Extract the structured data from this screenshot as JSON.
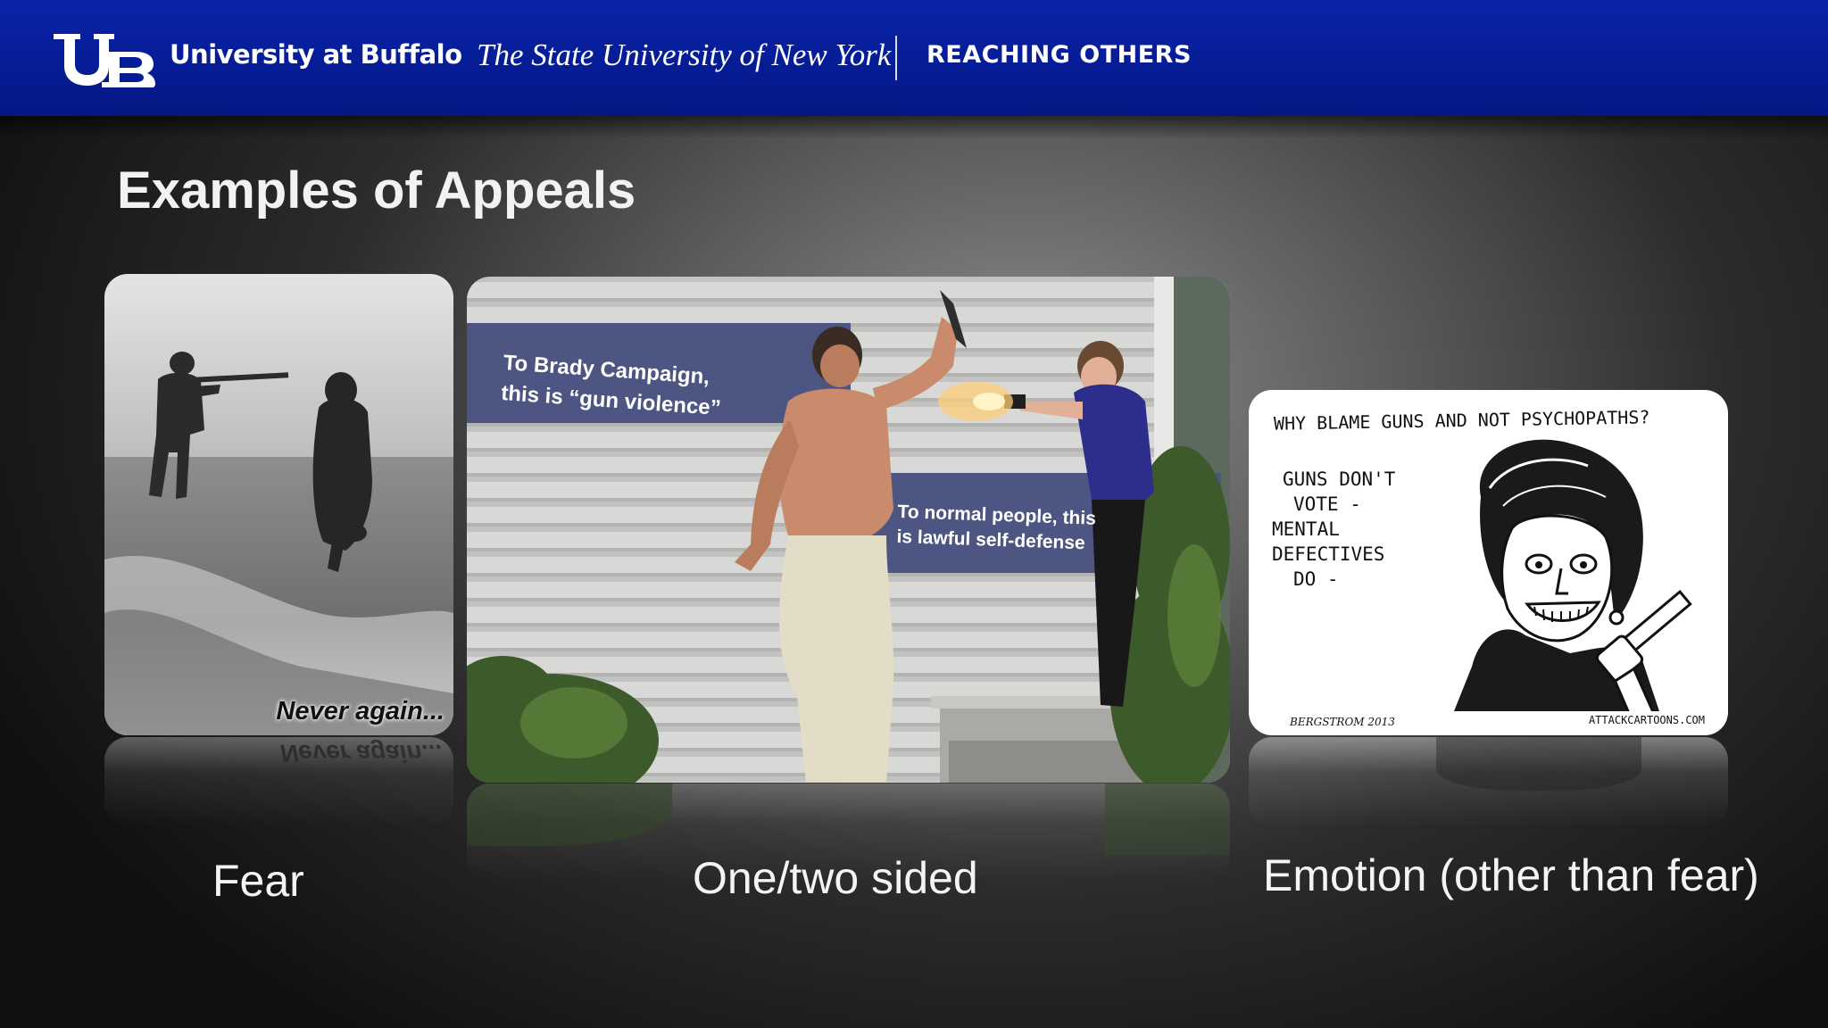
{
  "header": {
    "logo_text": "UB",
    "university": "University at Buffalo",
    "subtitle": "The State University of New York",
    "tagline": "REACHING OTHERS"
  },
  "slide": {
    "title": "Examples of Appeals"
  },
  "images": [
    {
      "caption": "Fear",
      "overlay": "Never again..."
    },
    {
      "caption": "One/two sided",
      "sign1_line1": "To Brady Campaign,",
      "sign1_line2": "this is “gun violence”",
      "sign2_line1": "To normal people, this",
      "sign2_line2": "is lawful self-defense"
    },
    {
      "caption": "Emotion (other than fear)",
      "cartoon_title": "WHY BLAME GUNS AND NOT PSYCHOPATHS?",
      "cartoon_text": [
        "GUNS DON'T",
        "VOTE -",
        "MENTAL",
        "DEFECTIVES",
        "DO -"
      ],
      "signature": "BERGSTROM 2013",
      "credit": "ATTACKCARTOONS.COM"
    }
  ],
  "colors": {
    "header_blue": "#061c95",
    "title_text": "#f2f2f2"
  }
}
